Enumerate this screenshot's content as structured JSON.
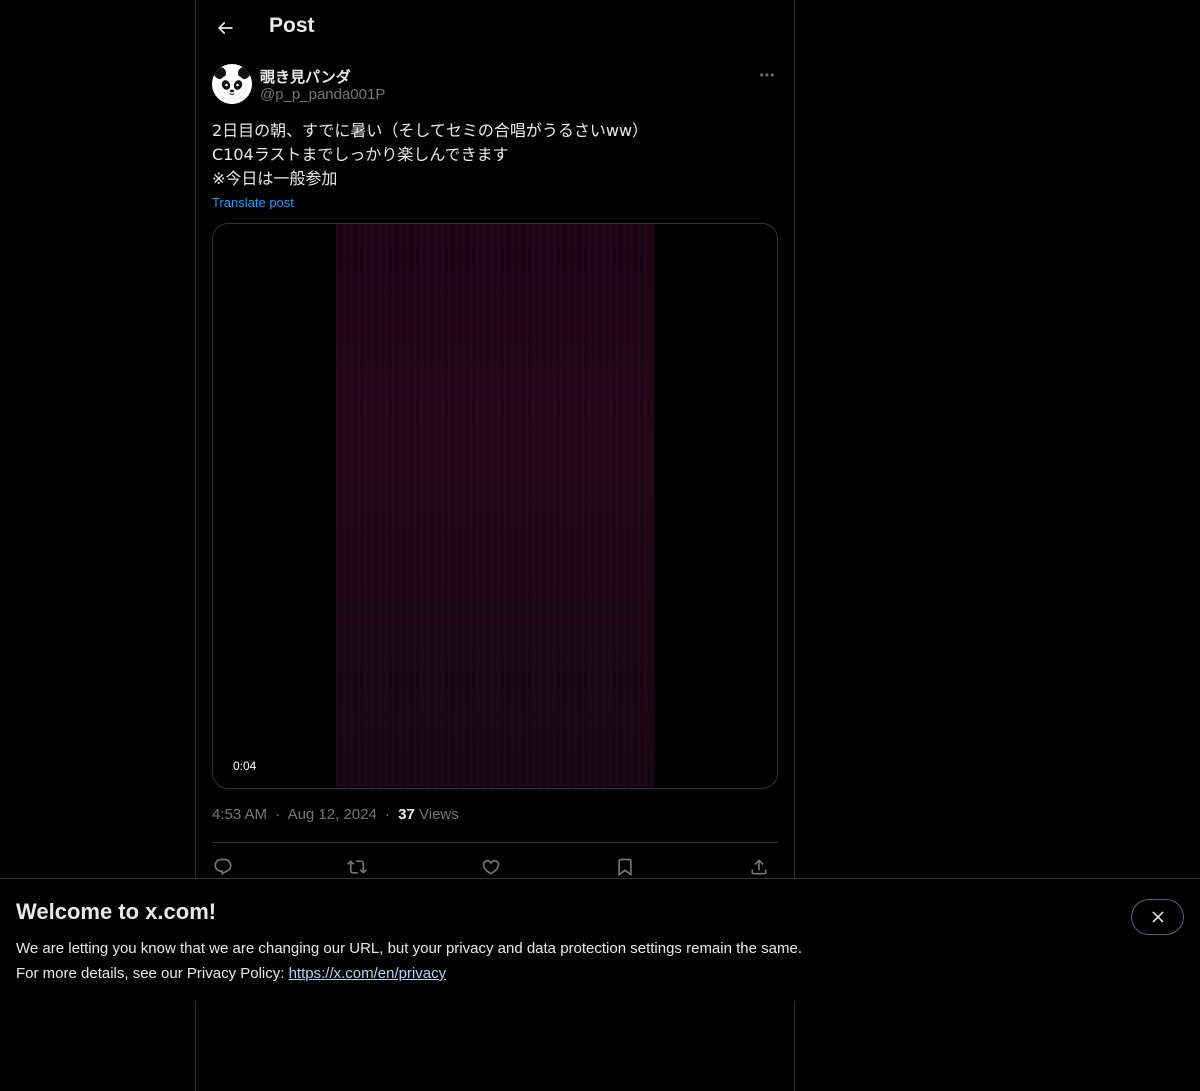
{
  "header": {
    "title": "Post",
    "back_icon": "arrow-left-icon"
  },
  "author": {
    "display_name": "覗き見パンダ",
    "handle": "@p_p_panda001P",
    "avatar_icon": "panda-avatar-icon",
    "more_icon": "more-horizontal-icon"
  },
  "post": {
    "lines": [
      "2日目の朝、すでに暑い（そしてセミの合唱がうるさいww）",
      "C104ラストまでしっかり楽しんできます",
      "※今日は一般参加"
    ],
    "translate_label": "Translate post",
    "video_duration": "0:04",
    "time": "4:53 AM",
    "separator": "·",
    "date": "Aug 12, 2024",
    "views_count": "37",
    "views_label": "Views"
  },
  "actions": {
    "reply_icon": "reply-icon",
    "repost_icon": "repost-icon",
    "like_icon": "heart-icon",
    "bookmark_icon": "bookmark-icon",
    "share_icon": "share-icon"
  },
  "banner": {
    "title": "Welcome to x.com!",
    "line1": "We are letting you know that we are changing our URL, but your privacy and data protection settings remain the same.",
    "line2_prefix": "For more details, see our Privacy Policy: ",
    "link_text": "https://x.com/en/privacy",
    "close_icon": "close-icon"
  },
  "colors": {
    "background": "#000000",
    "text_primary": "#e7e9ea",
    "text_secondary": "#71767b",
    "accent": "#1d9bf0",
    "border": "#2f3336"
  }
}
